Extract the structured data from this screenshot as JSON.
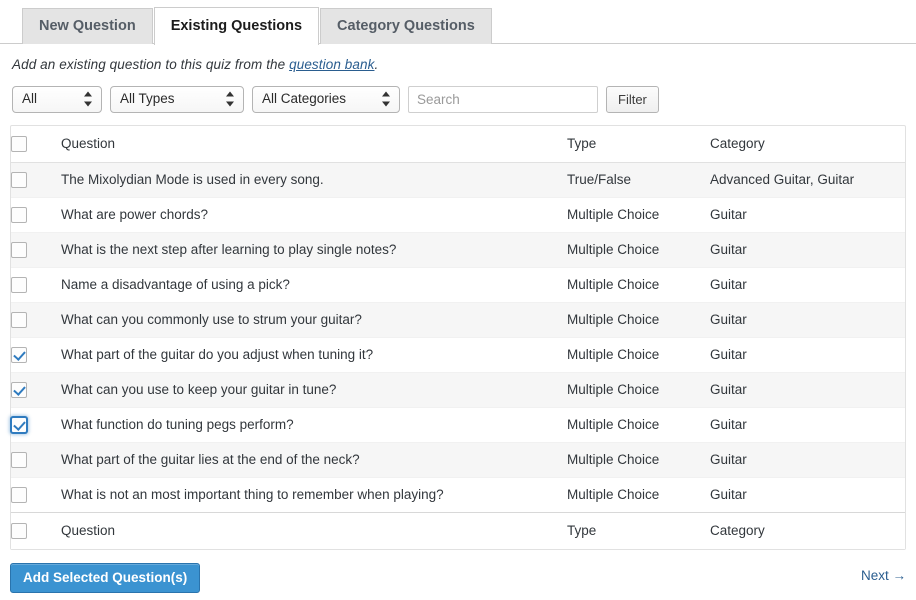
{
  "tabs": [
    {
      "label": "New Question",
      "active": false
    },
    {
      "label": "Existing Questions",
      "active": true
    },
    {
      "label": "Category Questions",
      "active": false
    }
  ],
  "description": {
    "prefix": "Add an existing question to this quiz from the ",
    "link_text": "question bank",
    "suffix": "."
  },
  "filters": {
    "status_select": {
      "value": "All"
    },
    "type_select": {
      "value": "All Types"
    },
    "category_select": {
      "value": "All Categories"
    },
    "search": {
      "value": "",
      "placeholder": "Search"
    },
    "filter_button": "Filter"
  },
  "table": {
    "columns": [
      "Question",
      "Type",
      "Category"
    ],
    "footer_columns": [
      "Question",
      "Type",
      "Category"
    ],
    "rows": [
      {
        "question": "The Mixolydian Mode is used in every song.",
        "type": "True/False",
        "category": "Advanced Guitar, Guitar",
        "checked": false,
        "focused": false
      },
      {
        "question": "What are power chords?",
        "type": "Multiple Choice",
        "category": "Guitar",
        "checked": false,
        "focused": false
      },
      {
        "question": "What is the next step after learning to play single notes?",
        "type": "Multiple Choice",
        "category": "Guitar",
        "checked": false,
        "focused": false
      },
      {
        "question": "Name a disadvantage of using a pick?",
        "type": "Multiple Choice",
        "category": "Guitar",
        "checked": false,
        "focused": false
      },
      {
        "question": "What can you commonly use to strum your guitar?",
        "type": "Multiple Choice",
        "category": "Guitar",
        "checked": false,
        "focused": false
      },
      {
        "question": "What part of the guitar do you adjust when tuning it?",
        "type": "Multiple Choice",
        "category": "Guitar",
        "checked": true,
        "focused": false
      },
      {
        "question": "What can you use to keep your guitar in tune?",
        "type": "Multiple Choice",
        "category": "Guitar",
        "checked": true,
        "focused": false
      },
      {
        "question": "What function do tuning pegs perform?",
        "type": "Multiple Choice",
        "category": "Guitar",
        "checked": true,
        "focused": true
      },
      {
        "question": "What part of the guitar lies at the end of the neck?",
        "type": "Multiple Choice",
        "category": "Guitar",
        "checked": false,
        "focused": false
      },
      {
        "question": "What is not an most important thing to remember when playing?",
        "type": "Multiple Choice",
        "category": "Guitar",
        "checked": false,
        "focused": false
      }
    ]
  },
  "actions": {
    "add_button": "Add Selected Question(s)",
    "next_link": "Next →"
  },
  "colors": {
    "accent_button": "#3b93d1",
    "link": "#2a5d8f",
    "checkbox_check": "#2f7bbf",
    "row_alt": "#f6f6f6",
    "tab_inactive": "#e4e4e4",
    "border": "#cccccc"
  }
}
